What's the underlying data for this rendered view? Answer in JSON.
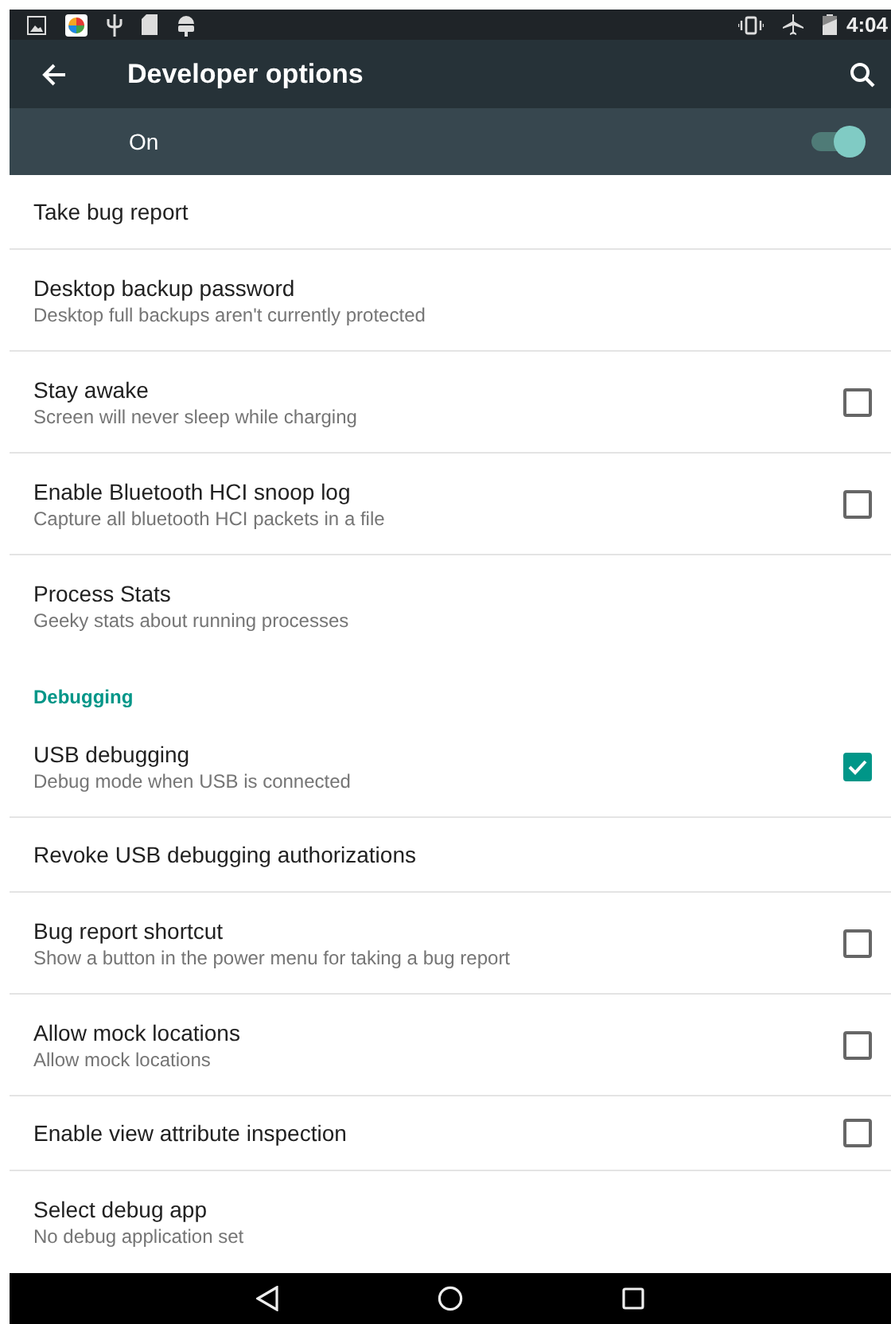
{
  "status_bar": {
    "time": "4:04"
  },
  "toolbar": {
    "title": "Developer options"
  },
  "master_switch": {
    "label": "On",
    "on": true
  },
  "sections": [
    {
      "items": [
        {
          "title": "Take bug report"
        },
        {
          "title": "Desktop backup password",
          "summary": "Desktop full backups aren't currently protected"
        },
        {
          "title": "Stay awake",
          "summary": "Screen will never sleep while charging",
          "checked": false
        },
        {
          "title": "Enable Bluetooth HCI snoop log",
          "summary": "Capture all bluetooth HCI packets in a file",
          "checked": false
        },
        {
          "title": "Process Stats",
          "summary": "Geeky stats about running processes"
        }
      ]
    },
    {
      "header": "Debugging",
      "items": [
        {
          "title": "USB debugging",
          "summary": "Debug mode when USB is connected",
          "checked": true
        },
        {
          "title": "Revoke USB debugging authorizations"
        },
        {
          "title": "Bug report shortcut",
          "summary": "Show a button in the power menu for taking a bug report",
          "checked": false
        },
        {
          "title": "Allow mock locations",
          "summary": "Allow mock locations",
          "checked": false
        },
        {
          "title": "Enable view attribute inspection",
          "checked": false
        },
        {
          "title": "Select debug app",
          "summary": "No debug application set"
        }
      ]
    }
  ]
}
